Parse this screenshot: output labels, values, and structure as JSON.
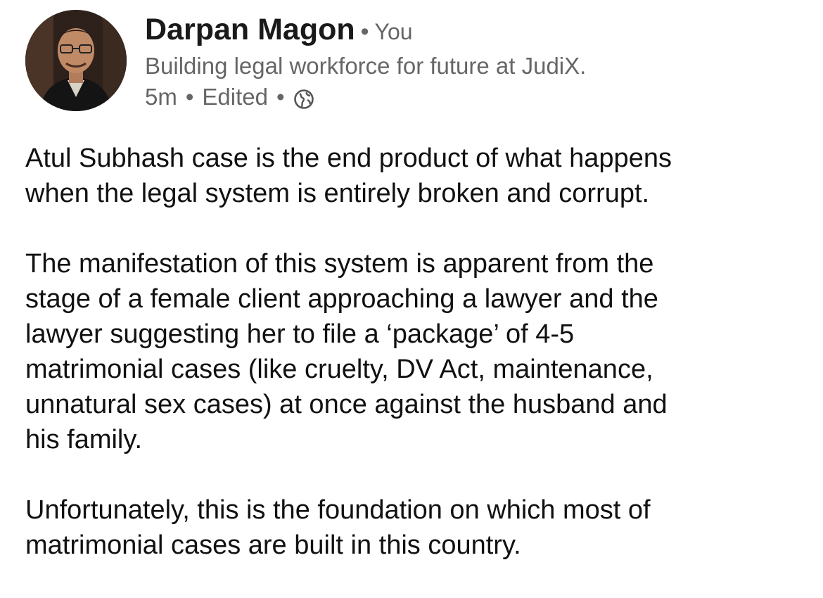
{
  "author": {
    "name": "Darpan Magon",
    "relation": "You",
    "headline": "Building legal workforce for future at JudiX.",
    "time": "5m",
    "edited": "Edited",
    "visibility_icon": "globe-icon"
  },
  "post": {
    "paragraphs": [
      {
        "lines": [
          "Atul Subhash case is the end product of what happens",
          "when the legal system is entirely broken and corrupt."
        ]
      },
      {
        "lines": [
          "The manifestation of this system is apparent from the",
          "stage of a female client approaching a lawyer and the",
          "lawyer suggesting her to file a ‘package’ of 4-5",
          "matrimonial cases (like cruelty, DV Act, maintenance,",
          "unnatural sex cases) at once against the husband and",
          "his family."
        ]
      },
      {
        "lines": [
          "Unfortunately, this is the foundation on which most of",
          "matrimonial cases are built in this country."
        ]
      }
    ]
  },
  "colors": {
    "text": "#111111",
    "secondary": "#666666",
    "background": "#ffffff"
  }
}
